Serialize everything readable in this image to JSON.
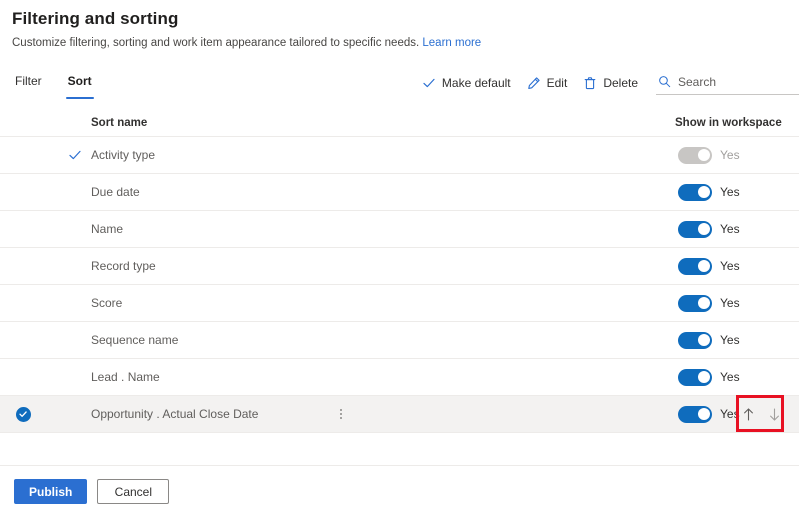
{
  "header": {
    "title": "Filtering and sorting",
    "subtitle": "Customize filtering, sorting and work item appearance tailored to specific needs.",
    "learn_more": "Learn more"
  },
  "tabs": [
    {
      "label": "Filter",
      "active": false
    },
    {
      "label": "Sort",
      "active": true
    }
  ],
  "commandbar": {
    "make_default": "Make default",
    "edit": "Edit",
    "delete": "Delete",
    "search_placeholder": "Search",
    "search_value": ""
  },
  "table": {
    "columns": {
      "sort_name": "Sort name",
      "show_in_workspace": "Show in workspace"
    },
    "rows": [
      {
        "name": "Activity type",
        "is_default": true,
        "selected": false,
        "toggle_on": true,
        "toggle_disabled": true,
        "toggle_label": "Yes"
      },
      {
        "name": "Due date",
        "is_default": false,
        "selected": false,
        "toggle_on": true,
        "toggle_disabled": false,
        "toggle_label": "Yes"
      },
      {
        "name": "Name",
        "is_default": false,
        "selected": false,
        "toggle_on": true,
        "toggle_disabled": false,
        "toggle_label": "Yes"
      },
      {
        "name": "Record type",
        "is_default": false,
        "selected": false,
        "toggle_on": true,
        "toggle_disabled": false,
        "toggle_label": "Yes"
      },
      {
        "name": "Score",
        "is_default": false,
        "selected": false,
        "toggle_on": true,
        "toggle_disabled": false,
        "toggle_label": "Yes"
      },
      {
        "name": "Sequence name",
        "is_default": false,
        "selected": false,
        "toggle_on": true,
        "toggle_disabled": false,
        "toggle_label": "Yes"
      },
      {
        "name": "Lead . Name",
        "is_default": false,
        "selected": false,
        "toggle_on": true,
        "toggle_disabled": false,
        "toggle_label": "Yes"
      },
      {
        "name": "Opportunity . Actual Close Date",
        "is_default": false,
        "selected": true,
        "toggle_on": true,
        "toggle_disabled": false,
        "toggle_label": "Yes"
      }
    ]
  },
  "footer": {
    "publish": "Publish",
    "cancel": "Cancel"
  },
  "colors": {
    "accent": "#2b6fd1",
    "toggle_on": "#0f6cbd",
    "toggle_disabled": "#c8c6c4",
    "annotation": "#e81123",
    "link": "#2b6fd1",
    "row_selected_bg": "#f3f2f1"
  }
}
